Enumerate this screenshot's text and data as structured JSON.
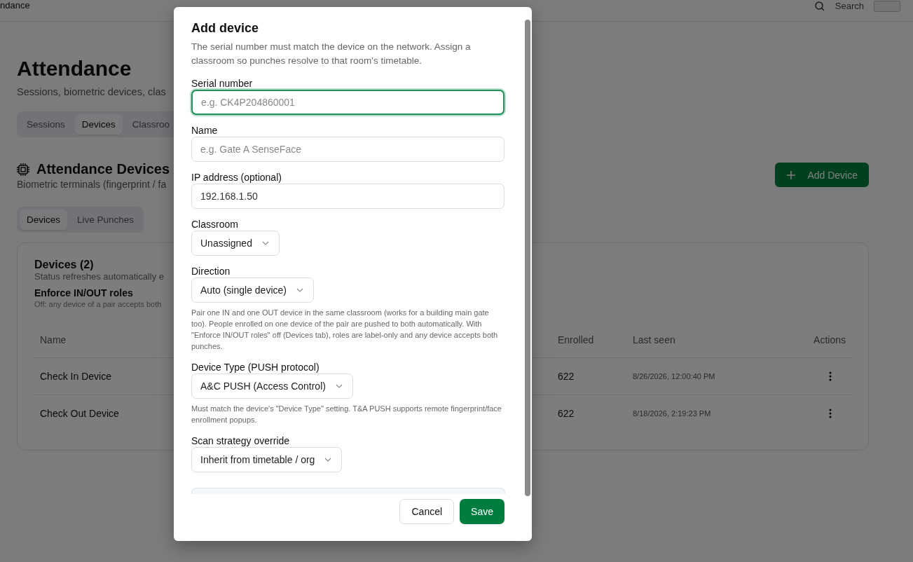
{
  "topbar": {
    "title": "ndance",
    "search": "Search"
  },
  "page": {
    "title": "Attendance",
    "subtitle": "Sessions, biometric devices, clas",
    "tabs": [
      {
        "label": "Sessions",
        "selected": false
      },
      {
        "label": "Devices",
        "selected": true
      },
      {
        "label": "Classroo",
        "selected": false
      }
    ],
    "section": {
      "title": "Attendance Devices",
      "subtitle": "Biometric terminals (fingerprint / fa",
      "add_button": "Add Device"
    },
    "subtabs": [
      {
        "label": "Devices",
        "selected": true
      },
      {
        "label": "Live Punches",
        "selected": false
      }
    ],
    "card": {
      "title": "Devices (2)",
      "subtitle": "Status refreshes automatically e",
      "setting_title": "Enforce IN/OUT roles",
      "setting_hint": "Off: any device of a pair accepts both",
      "columns": [
        "Name",
        "Enrolled",
        "Last seen",
        "Actions"
      ],
      "rows": [
        {
          "name": "Check In Device",
          "enrolled": "622",
          "last_seen": "8/26/2026, 12:00:40 PM"
        },
        {
          "name": "Check Out Device",
          "enrolled": "622",
          "last_seen": "8/18/2026, 2:19:23 PM"
        }
      ]
    }
  },
  "dialog": {
    "title": "Add device",
    "description": "The serial number must match the device on the network. Assign a classroom so punches resolve to that room's timetable.",
    "fields": [
      {
        "kind": "input",
        "label": "Serial number",
        "placeholder": "e.g. CK4P204860001",
        "focused": true
      },
      {
        "kind": "input",
        "label": "Name",
        "placeholder": "e.g. Gate A SenseFace",
        "focused": false
      },
      {
        "kind": "input",
        "label": "IP address (optional)",
        "value": "192.168.1.50",
        "focused": false
      },
      {
        "kind": "select",
        "label": "Classroom",
        "value": "Unassigned",
        "focused": false
      },
      {
        "kind": "select",
        "label": "Direction",
        "value": "Auto (single device)",
        "focused": false,
        "hint": "Pair one IN and one OUT device in the same classroom (works for a building main gate too). People enrolled on one device of the pair are pushed to both automatically. With \"Enforce IN/OUT roles\" off (Devices tab), roles are label-only and any device accepts both punches."
      },
      {
        "kind": "select",
        "label": "Device Type (PUSH protocol)",
        "value": "A&C PUSH (Access Control)",
        "focused": false,
        "hint": "Must match the device's \"Device Type\" setting. T&A PUSH supports remote fingerprint/face enrollment popups."
      },
      {
        "kind": "select",
        "label": "Scan strategy override",
        "value": "Inherit from timetable / org",
        "focused": false
      },
      {
        "kind": "panel"
      }
    ],
    "buttons": [
      {
        "label": "Cancel",
        "kind": "secondary"
      },
      {
        "label": "Save",
        "kind": "primary"
      }
    ]
  }
}
